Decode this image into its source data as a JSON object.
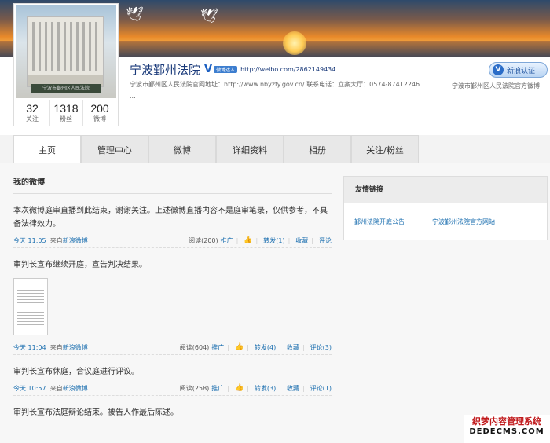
{
  "profile": {
    "name": "宁波鄞州法院",
    "verify_mark": "V",
    "verify_badge": "微博达人",
    "weibo_url": "http://weibo.com/2862149434",
    "info_line1": "宁波市鄞州区人民法院官网地址：http://www.nbyzfy.gov.cn/ 联系电话：立案大厅：0574-87412246",
    "info_line2": "...",
    "stats": [
      {
        "num": "32",
        "label": "关注"
      },
      {
        "num": "1318",
        "label": "粉丝"
      },
      {
        "num": "200",
        "label": "微博"
      }
    ],
    "avatar_plate": "宁波市鄞州区人民法院"
  },
  "verify": {
    "button_label": "新浪认证",
    "v": "V",
    "text": "宁波市鄞州区人民法院官方微博"
  },
  "tabs": [
    "主页",
    "管理中心",
    "微博",
    "详细资料",
    "相册",
    "关注/粉丝"
  ],
  "feed": {
    "title": "我的微博",
    "posts": [
      {
        "text": "本次微博庭审直播到此结束，谢谢关注。上述微博直播内容不是庭审笔录，仅供参考，不具备法律效力。",
        "time": "今天 11:05",
        "src_prefix": "来自",
        "src": "新浪微博",
        "read": "阅读(200)",
        "promote": "推广",
        "forward": "转发(1)",
        "fav": "收藏",
        "comment": "评论"
      },
      {
        "text": "审判长宣布继续开庭，宣告判决结果。",
        "time": "今天 11:04",
        "src_prefix": "来自",
        "src": "新浪微博",
        "read": "阅读(604)",
        "promote": "推广",
        "forward": "转发(4)",
        "fav": "收藏",
        "comment": "评论(3)"
      },
      {
        "text": "审判长宣布休庭，合议庭进行评议。",
        "time": "今天 10:57",
        "src_prefix": "来自",
        "src": "新浪微博",
        "read": "阅读(258)",
        "promote": "推广",
        "forward": "转发(3)",
        "fav": "收藏",
        "comment": "评论(1)"
      },
      {
        "text": "审判长宣布法庭辩论结束。被告人作最后陈述。"
      }
    ]
  },
  "sidebar": {
    "title": "友情链接",
    "links": [
      "鄞州法院开庭公告",
      "宁波鄞州法院官方网站"
    ]
  },
  "watermark": {
    "line1": "织梦内容管理系统",
    "line2": "DEDECMS.COM"
  }
}
